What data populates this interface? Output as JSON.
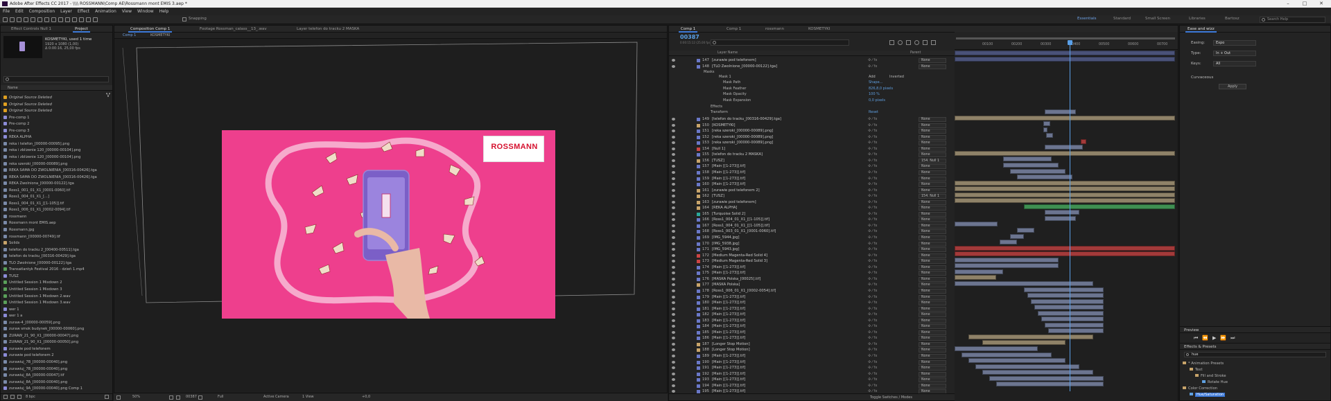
{
  "app": {
    "title": "Adobe After Effects CC 2017 - \\\\\\\\ ROSSMANN\\Comp AE\\Rossmann mont EMIS 3.aep *"
  },
  "menu": [
    "File",
    "Edit",
    "Composition",
    "Layer",
    "Effect",
    "Animation",
    "View",
    "Window",
    "Help"
  ],
  "toolbar": {
    "snapping_label": "Snapping",
    "workspaces": [
      "Essentials",
      "Standard",
      "Small Screen",
      "Libraries",
      "Bartosz"
    ],
    "search_placeholder": "Search Help"
  },
  "left_panel": {
    "tabs": [
      "Effect Controls Null 1",
      "Project"
    ],
    "item_name": "KOSMETYKI",
    "item_used": ", used 1 time",
    "item_size": "1920 x 1080 (1,00)",
    "item_duration": "Δ 0:00:16, 25,00 fps",
    "search_placeholder": "",
    "column_name": "Name",
    "items": [
      "Original Source Deleted",
      "Original Source Deleted",
      "Original Source Deleted",
      "Pre-comp 1",
      "Pre-comp 2",
      "Pre-comp 3",
      "REKA ALPHA",
      "reka i telefon_[00000-00095].png",
      "reka i zblizenie 120_[00000-00104].png",
      "reka i zblizenie 120_[00000-00104].png",
      "reka szeroki_[00000-00089].png",
      "REKA SAMA DO ZWOLNIENIA_[00316-00426].tga",
      "REKA SAMA DO ZWOLNIENIA_[00316-00426].tga",
      "REKA Zwolniona_[00000-00122].tga",
      "Ross1_001_01_X1_[0001-0060].tif",
      "Ross1_004_01_X1_[...]",
      "Ross1_004_01_X1_[[1-105]].tif",
      "Ross1_006_01_X1_[0002-0094].tif",
      "rossmann",
      "Rossmann mont EMIS.aep",
      "Rossmann.jpg",
      "rossmann_[00000-00749].tif",
      "Solids",
      "telefon do tracku 2_[00400-00511].tga",
      "telefon do tracku_[00316-00429].tga",
      "TLO Zwolnione_[00000-00122].tga",
      "Transatlantyk Festival 2016 - dzień 1.mp4",
      "TUSZ",
      "Untitled Session 1 Mixdown 2",
      "Untitled Session 1 Mixdown 3",
      "Untitled Session 1 Mixdown 2.wav",
      "Untitled Session 1 Mixdown 3.wav",
      "wer 1",
      "wer 1 a",
      "zuraw-4_[00000-00059].png",
      "zuraw smok budynek_[00000-00060].png",
      "ZURAW_21_90_X1_[00000-00047].png",
      "ZURAW_21_90_X1_[00000-00050].png",
      "zurawie pod telefonem",
      "zurawie pod telefonem 2",
      "zurawiuj_7B_[00000-00040].png",
      "zurawiuj_7B_[00000-00040].png",
      "zurawiuj_8A_[00000-00047].tif",
      "zurawiuj_8A_[00000-00040].png",
      "zurawiuj_9A_[00000-00040].png Comp 1",
      "zurawiuj_9A_[00000-00040].png Comp 2"
    ],
    "footer": "8 bpc"
  },
  "comp_panel": {
    "tabs": [
      "Composition Comp 1",
      "Footage Rossman_calass__13_.wav",
      "Layer telefon do tracku 2 MASKA"
    ],
    "sub_tabs": [
      "Comp 1",
      "KOSMETYKI"
    ],
    "logo_text": "ROSSMANN",
    "footer": {
      "zoom": "50%",
      "timecode": "00387",
      "resolution": "Full",
      "camera": "Active Camera",
      "view": "1 View",
      "exposure": "+0,0"
    }
  },
  "timeline": {
    "tabs": [
      "Comp 1",
      "Comp 1",
      "rossmann",
      "KOSMETYKI"
    ],
    "timecode": "00387",
    "timecode_sub": "0:00:15:12 (25.00 fps)",
    "search_placeholder": "",
    "col_layer_name": "Layer Name",
    "col_parent": "Parent",
    "ruler_labels": [
      "00100",
      "00200",
      "00300",
      "00400",
      "00500",
      "00600",
      "00700"
    ],
    "mask_section": {
      "masks_label": "Masks",
      "mask_name": "Mask 1",
      "mode": "Add",
      "inverted_label": "Inverted",
      "props": [
        {
          "name": "Mask Path",
          "value": "Shape..."
        },
        {
          "name": "Mask Feather",
          "value": "826,8,0 pixels"
        },
        {
          "name": "Mask Opacity",
          "value": "100 %"
        },
        {
          "name": "Mask Expansion",
          "value": "0,0 pixels"
        }
      ],
      "effects_label": "Effects",
      "transform_label": "Transform",
      "reset_label": "Reset"
    },
    "layers_top": [
      {
        "num": "147",
        "name": "[zurawie pod telefonem]",
        "color": "#6a78c8",
        "parent": "None"
      },
      {
        "num": "148",
        "name": "[TLO Zwolnione_[00000-00122].tga]",
        "color": "#6a78c8",
        "parent": "None"
      }
    ],
    "layers": [
      {
        "num": "149",
        "name": "[telefon do tracku_[00316-00429].tga]",
        "color": "#6a78c8",
        "parent": "None"
      },
      {
        "num": "150",
        "name": "[KOSMETYKI]",
        "color": "#c8a46a",
        "parent": "None"
      },
      {
        "num": "151",
        "name": "[reka szeroki_[00000-00089].png]",
        "color": "#6a78c8",
        "parent": "None"
      },
      {
        "num": "152",
        "name": "[reka szeroki_[00000-00089].png]",
        "color": "#6a78c8",
        "parent": "None"
      },
      {
        "num": "153",
        "name": "[reka szeroki_[00000-00089].png]",
        "color": "#6a78c8",
        "parent": "None"
      },
      {
        "num": "154",
        "name": "[Null 1]",
        "color": "#c44",
        "parent": "None"
      },
      {
        "num": "155",
        "name": "[telefon do tracku 2 MASKA]",
        "color": "#6a78c8",
        "parent": "None"
      },
      {
        "num": "156",
        "name": "[TUSZ]",
        "color": "#c8a46a",
        "parent": "154. Null 1"
      },
      {
        "num": "157",
        "name": "[Main [[1-273]].tif]",
        "color": "#6a78c8",
        "parent": "None"
      },
      {
        "num": "158",
        "name": "[Main [[1-273]].tif]",
        "color": "#6a78c8",
        "parent": "None"
      },
      {
        "num": "159",
        "name": "[Main [[1-273]].tif]",
        "color": "#6a78c8",
        "parent": "None"
      },
      {
        "num": "160",
        "name": "[Main [[1-273]].tif]",
        "color": "#6a78c8",
        "parent": "None"
      },
      {
        "num": "161",
        "name": "[zurawie pod telefonem 2]",
        "color": "#c8a46a",
        "parent": "None"
      },
      {
        "num": "162",
        "name": "[TUSZ]",
        "color": "#c8a46a",
        "parent": "154. Null 1"
      },
      {
        "num": "163",
        "name": "[zurawie pod telefonem]",
        "color": "#c8a46a",
        "parent": "None"
      },
      {
        "num": "164",
        "name": "[REKA ALPHA]",
        "color": "#c8a46a",
        "parent": "None"
      },
      {
        "num": "165",
        "name": "[Turquoise Solid 2]",
        "color": "#2aa89a",
        "parent": "None"
      },
      {
        "num": "166",
        "name": "[Ross1_004_01_X1_[[1-105]].tif]",
        "color": "#6a78c8",
        "parent": "None"
      },
      {
        "num": "167",
        "name": "[Ross1_004_01_X1_[[1-105]].tif]",
        "color": "#6a78c8",
        "parent": "None"
      },
      {
        "num": "168",
        "name": "[Ross1_003_01_X1_[0001-0060].tif]",
        "color": "#6a78c8",
        "parent": "None"
      },
      {
        "num": "169",
        "name": "[IMG_5944.jpg]",
        "color": "#6a78c8",
        "parent": "None"
      },
      {
        "num": "170",
        "name": "[IMG_5938.jpg]",
        "color": "#6a78c8",
        "parent": "None"
      },
      {
        "num": "171",
        "name": "[IMG_5943.jpg]",
        "color": "#6a78c8",
        "parent": "None"
      },
      {
        "num": "172",
        "name": "[Medium Magenta-Red Solid 4]",
        "color": "#c44",
        "parent": "None"
      },
      {
        "num": "173",
        "name": "[Medium Magenta-Red Solid 3]",
        "color": "#c44",
        "parent": "None"
      },
      {
        "num": "174",
        "name": "[Main [[1-273]].tif]",
        "color": "#6a78c8",
        "parent": "None"
      },
      {
        "num": "175",
        "name": "[Main [[1-273]].tif]",
        "color": "#6a78c8",
        "parent": "None"
      },
      {
        "num": "176",
        "name": "[MASKA Polska_[00025].tif]",
        "color": "#6a78c8",
        "parent": "None"
      },
      {
        "num": "177",
        "name": "[MASKA Polska]",
        "color": "#c8a46a",
        "parent": "None"
      },
      {
        "num": "178",
        "name": "[Ross1_006_01_X1_[0002-0054].tif]",
        "color": "#6a78c8",
        "parent": "None"
      },
      {
        "num": "179",
        "name": "[Main [[1-273]].tif]",
        "color": "#6a78c8",
        "parent": "None"
      },
      {
        "num": "180",
        "name": "[Main [[1-273]].tif]",
        "color": "#6a78c8",
        "parent": "None"
      },
      {
        "num": "181",
        "name": "[Main [[1-273]].tif]",
        "color": "#6a78c8",
        "parent": "None"
      },
      {
        "num": "182",
        "name": "[Main [[1-273]].tif]",
        "color": "#6a78c8",
        "parent": "None"
      },
      {
        "num": "183",
        "name": "[Main [[1-273]].tif]",
        "color": "#6a78c8",
        "parent": "None"
      },
      {
        "num": "184",
        "name": "[Main [[1-273]].tif]",
        "color": "#6a78c8",
        "parent": "None"
      },
      {
        "num": "185",
        "name": "[Main [[1-273]].tif]",
        "color": "#6a78c8",
        "parent": "None"
      },
      {
        "num": "186",
        "name": "[Main [[1-273]].tif]",
        "color": "#6a78c8",
        "parent": "None"
      },
      {
        "num": "187",
        "name": "[Longer Stop Motion]",
        "color": "#c8a46a",
        "parent": "None"
      },
      {
        "num": "188",
        "name": "[Longer Stop Motion]",
        "color": "#c8a46a",
        "parent": "None"
      },
      {
        "num": "189",
        "name": "[Main [[1-273]].tif]",
        "color": "#6a78c8",
        "parent": "None"
      },
      {
        "num": "190",
        "name": "[Main [[1-273]].tif]",
        "color": "#6a78c8",
        "parent": "None"
      },
      {
        "num": "191",
        "name": "[Main [[1-273]].tif]",
        "color": "#6a78c8",
        "parent": "None"
      },
      {
        "num": "192",
        "name": "[Main [[1-273]].tif]",
        "color": "#6a78c8",
        "parent": "None"
      },
      {
        "num": "193",
        "name": "[Main [[1-273]].tif]",
        "color": "#6a78c8",
        "parent": "None"
      },
      {
        "num": "194",
        "name": "[Main [[1-273]].tif]",
        "color": "#6a78c8",
        "parent": "None"
      },
      {
        "num": "195",
        "name": "[Main [[1-273]].tif]",
        "color": "#6a78c8",
        "parent": "None"
      }
    ],
    "footer": "Toggle Switches / Modes"
  },
  "right_panel": {
    "title": "Ease and wizz",
    "rows": [
      {
        "label": "Easing:",
        "value": "Expo"
      },
      {
        "label": "Type:",
        "value": "In + Out"
      },
      {
        "label": "Keys:",
        "value": "All"
      }
    ],
    "curvaceous_label": "Curvaceous",
    "apply_label": "Apply",
    "preview_title": "Preview",
    "effects_title": "Effects & Presets",
    "effects_search": "hue",
    "tree": [
      "* Animation Presets",
      "Text",
      "Fill and Stroke",
      "Rotate Hue",
      "Color Correction",
      "Hue/Saturation"
    ]
  },
  "colors": {
    "accent": "#3b78d8",
    "pink_background": "#ee3f8d",
    "rossmann_red": "#d5102e",
    "playhead": "#5aa0e8"
  }
}
